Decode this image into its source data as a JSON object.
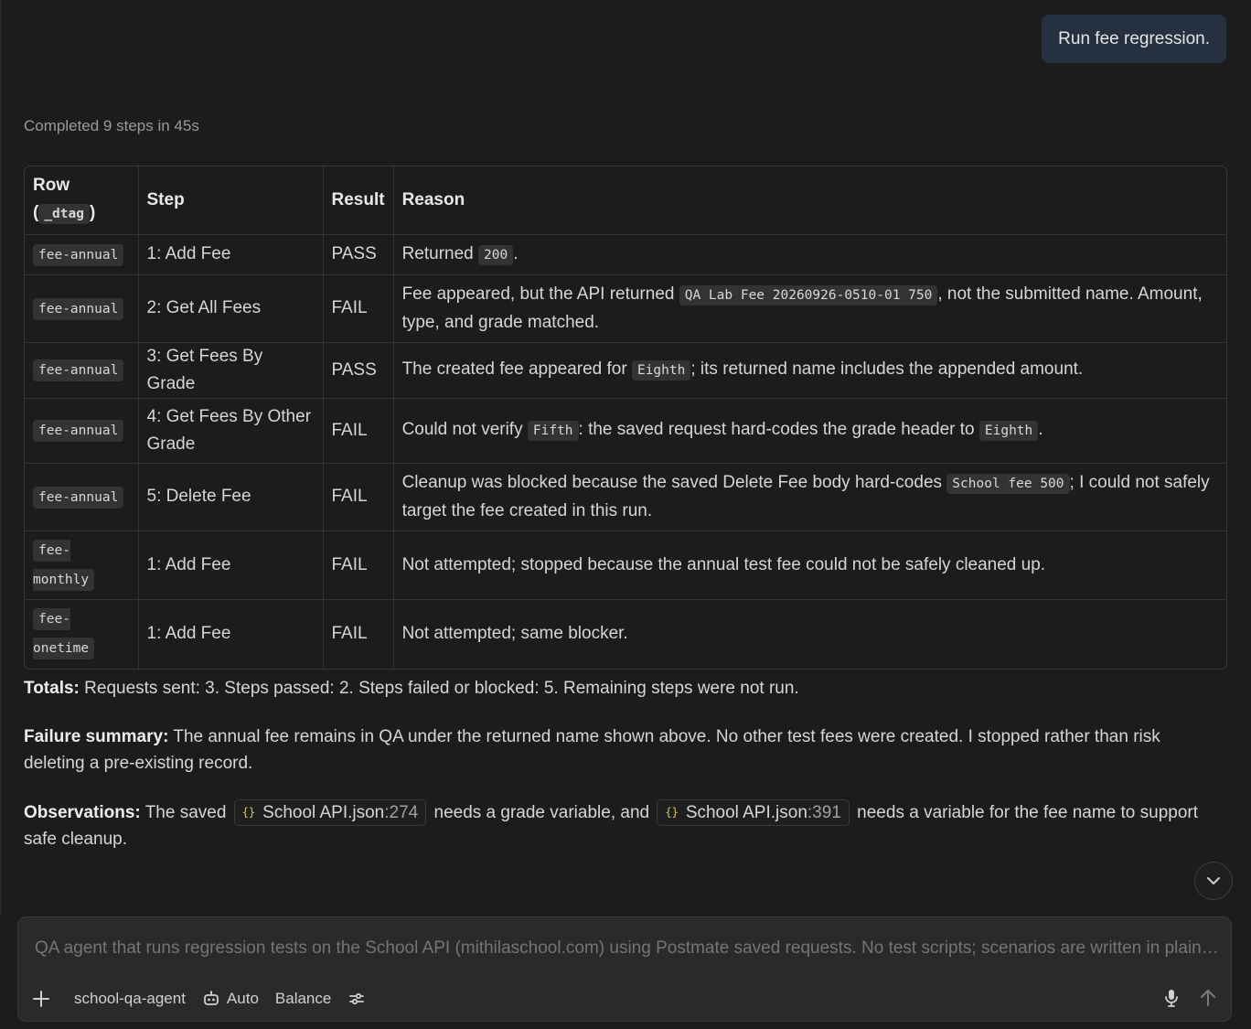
{
  "user_message": "Run fee regression.",
  "status": "Completed 9 steps in 45s",
  "table": {
    "headers": {
      "row": "Row",
      "row_tag": "_dtag",
      "step": "Step",
      "result": "Result",
      "reason": "Reason"
    },
    "rows": [
      {
        "tag": "fee-annual",
        "step": "1: Add Fee",
        "result": "PASS",
        "reason": [
          {
            "t": "Returned "
          },
          {
            "c": "200"
          },
          {
            "t": "."
          }
        ]
      },
      {
        "tag": "fee-annual",
        "step": "2: Get All Fees",
        "result": "FAIL",
        "reason": [
          {
            "t": "Fee appeared, but the API returned "
          },
          {
            "c": "QA Lab Fee 20260926-0510-01 750"
          },
          {
            "t": ", not the submitted name. Amount, type, and grade matched."
          }
        ]
      },
      {
        "tag": "fee-annual",
        "step": "3: Get Fees By Grade",
        "result": "PASS",
        "reason": [
          {
            "t": "The created fee appeared for "
          },
          {
            "c": "Eighth"
          },
          {
            "t": "; its returned name includes the appended amount."
          }
        ]
      },
      {
        "tag": "fee-annual",
        "step": "4: Get Fees By Other Grade",
        "result": "FAIL",
        "reason": [
          {
            "t": "Could not verify "
          },
          {
            "c": "Fifth"
          },
          {
            "t": ": the saved request hard-codes the grade header to "
          },
          {
            "c": "Eighth"
          },
          {
            "t": "."
          }
        ]
      },
      {
        "tag": "fee-annual",
        "step": "5: Delete Fee",
        "result": "FAIL",
        "reason": [
          {
            "t": "Cleanup was blocked because the saved Delete Fee body hard-codes "
          },
          {
            "c": "School fee 500"
          },
          {
            "t": "; I could not safely target the fee created in this run."
          }
        ]
      },
      {
        "tag": "fee-monthly",
        "step": "1: Add Fee",
        "result": "FAIL",
        "reason": [
          {
            "t": "Not attempted; stopped because the annual test fee could not be safely cleaned up."
          }
        ]
      },
      {
        "tag": "fee-onetime",
        "step": "1: Add Fee",
        "result": "FAIL",
        "reason": [
          {
            "t": "Not attempted; same blocker."
          }
        ]
      }
    ]
  },
  "totals": {
    "label": "Totals:",
    "text": " Requests sent: 3. Steps passed: 2. Steps failed or blocked: 5. Remaining steps were not run."
  },
  "failure_summary": {
    "label": "Failure summary:",
    "text": " The annual fee remains in QA under the returned name shown above. No other test fees were created. I stopped rather than risk deleting a pre-existing record."
  },
  "observations": {
    "label": "Observations:",
    "pre": " The saved",
    "file1": {
      "name": "School API.json",
      "line": ":274"
    },
    "mid": "needs a grade variable, and",
    "file2": {
      "name": "School API.json",
      "line": ":391"
    },
    "post": "needs a variable for the fee name to support safe cleanup."
  },
  "composer": {
    "placeholder": "QA agent that runs regression tests on the School API (mithilaschool.com) using Postmate saved requests. No test scripts; scenarios are written in plain English.",
    "agent_name": "school-qa-agent",
    "model": "Auto",
    "mode": "Balance"
  }
}
